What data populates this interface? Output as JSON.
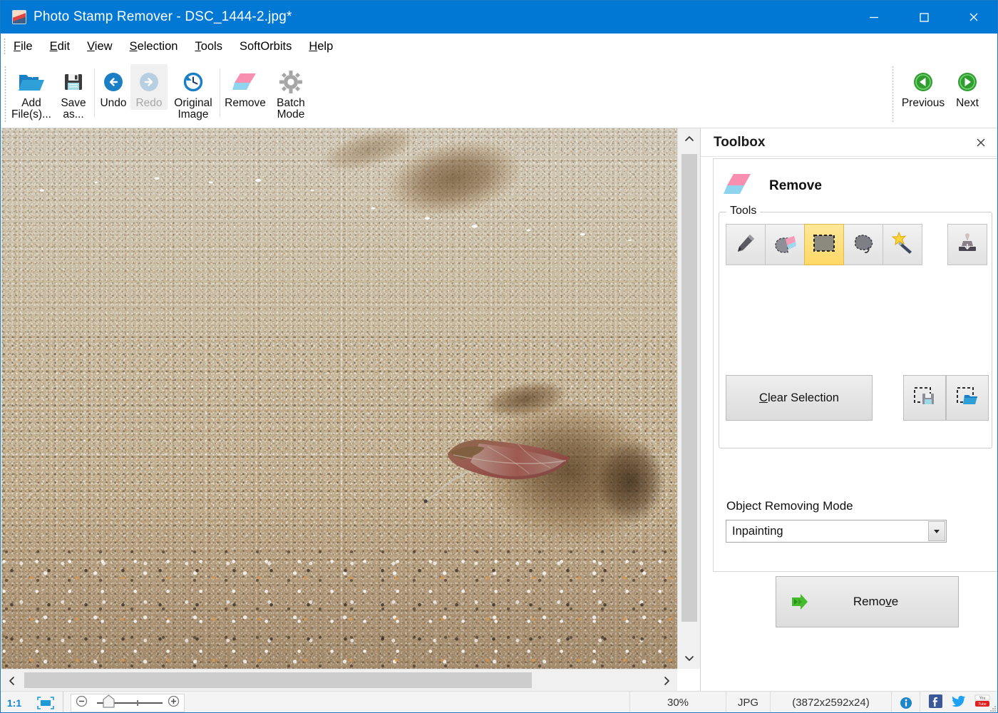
{
  "window": {
    "title": "Photo Stamp Remover - DSC_1444-2.jpg*",
    "app_icon": "app-photo-icon",
    "minimize_label": "Minimize",
    "maximize_label": "Maximize",
    "close_label": "Close"
  },
  "menu": {
    "items": [
      {
        "label": "File",
        "accel": "F"
      },
      {
        "label": "Edit",
        "accel": "E"
      },
      {
        "label": "View",
        "accel": "V"
      },
      {
        "label": "Selection",
        "accel": "S"
      },
      {
        "label": "Tools",
        "accel": "T"
      },
      {
        "label": "SoftOrbits",
        "accel": ""
      },
      {
        "label": "Help",
        "accel": "H"
      }
    ]
  },
  "toolbar": {
    "buttons": [
      {
        "id": "add-files",
        "label": "Add\nFile(s)...",
        "icon": "open-folder-icon",
        "disabled": false
      },
      {
        "id": "save-as",
        "label": "Save\nas...",
        "icon": "floppy-disk-icon",
        "disabled": false
      },
      {
        "id": "undo",
        "label": "Undo",
        "icon": "undo-arrow-icon",
        "disabled": false
      },
      {
        "id": "redo",
        "label": "Redo",
        "icon": "redo-arrow-icon",
        "disabled": true
      },
      {
        "id": "original-image",
        "label": "Original\nImage",
        "icon": "clock-revert-icon",
        "disabled": false
      },
      {
        "id": "remove",
        "label": "Remove",
        "icon": "eraser-icon",
        "disabled": false
      },
      {
        "id": "batch-mode",
        "label": "Batch\nMode",
        "icon": "gear-icon",
        "disabled": false
      }
    ],
    "nav": [
      {
        "id": "previous",
        "label": "Previous",
        "icon": "green-left-arrow-icon"
      },
      {
        "id": "next",
        "label": "Next",
        "icon": "green-right-arrow-icon"
      }
    ]
  },
  "toolbox": {
    "title": "Toolbox",
    "close_icon": "close-icon",
    "section": {
      "icon": "eraser-icon",
      "title": "Remove"
    },
    "tools_group_label": "Tools",
    "tools": [
      {
        "id": "marker",
        "icon": "pencil-icon",
        "active": false
      },
      {
        "id": "eraser",
        "icon": "eraser-tool-icon",
        "active": false
      },
      {
        "id": "rect-select",
        "icon": "rectangle-select-icon",
        "active": true
      },
      {
        "id": "lasso",
        "icon": "lasso-icon",
        "active": false
      },
      {
        "id": "magic-wand",
        "icon": "magic-wand-icon",
        "active": false
      }
    ],
    "stamp_tool": {
      "id": "stamp",
      "icon": "stamp-icon",
      "active": false
    },
    "clear_selection_label": "Clear Selection",
    "selection_io": [
      {
        "id": "save-selection",
        "icon": "save-selection-icon"
      },
      {
        "id": "load-selection",
        "icon": "load-selection-icon"
      }
    ],
    "mode_label": "Object Removing Mode",
    "mode_value": "Inpainting",
    "mode_options": [
      "Inpainting"
    ],
    "remove_button": {
      "label": "Remove",
      "icon": "green-double-arrow-icon"
    }
  },
  "canvas": {
    "vertical_scrollbar": {
      "up_icon": "chevron-up-icon",
      "down_icon": "chevron-down-icon"
    },
    "horizontal_scrollbar": {
      "left_icon": "chevron-left-icon",
      "right_icon": "chevron-right-icon"
    }
  },
  "statusbar": {
    "zoom_ratio": "1:1",
    "fit_icon": "fit-to-window-icon",
    "zoom_out_icon": "zoom-out-icon",
    "zoom_in_icon": "zoom-in-icon",
    "zoom_percent": "30%",
    "format": "JPG",
    "dimensions": "(3872x2592x24)",
    "info_icon": "info-icon",
    "social": [
      {
        "id": "facebook",
        "icon": "facebook-icon",
        "color": "#3b5998"
      },
      {
        "id": "twitter",
        "icon": "twitter-icon",
        "color": "#1da1f2"
      },
      {
        "id": "youtube",
        "icon": "youtube-icon",
        "color": "#e02020"
      }
    ]
  },
  "colors": {
    "title_bar": "#0078d4",
    "accent": "#0b86d0",
    "active_tool": "#ffd866",
    "nav_green": "#2f9e2f"
  }
}
